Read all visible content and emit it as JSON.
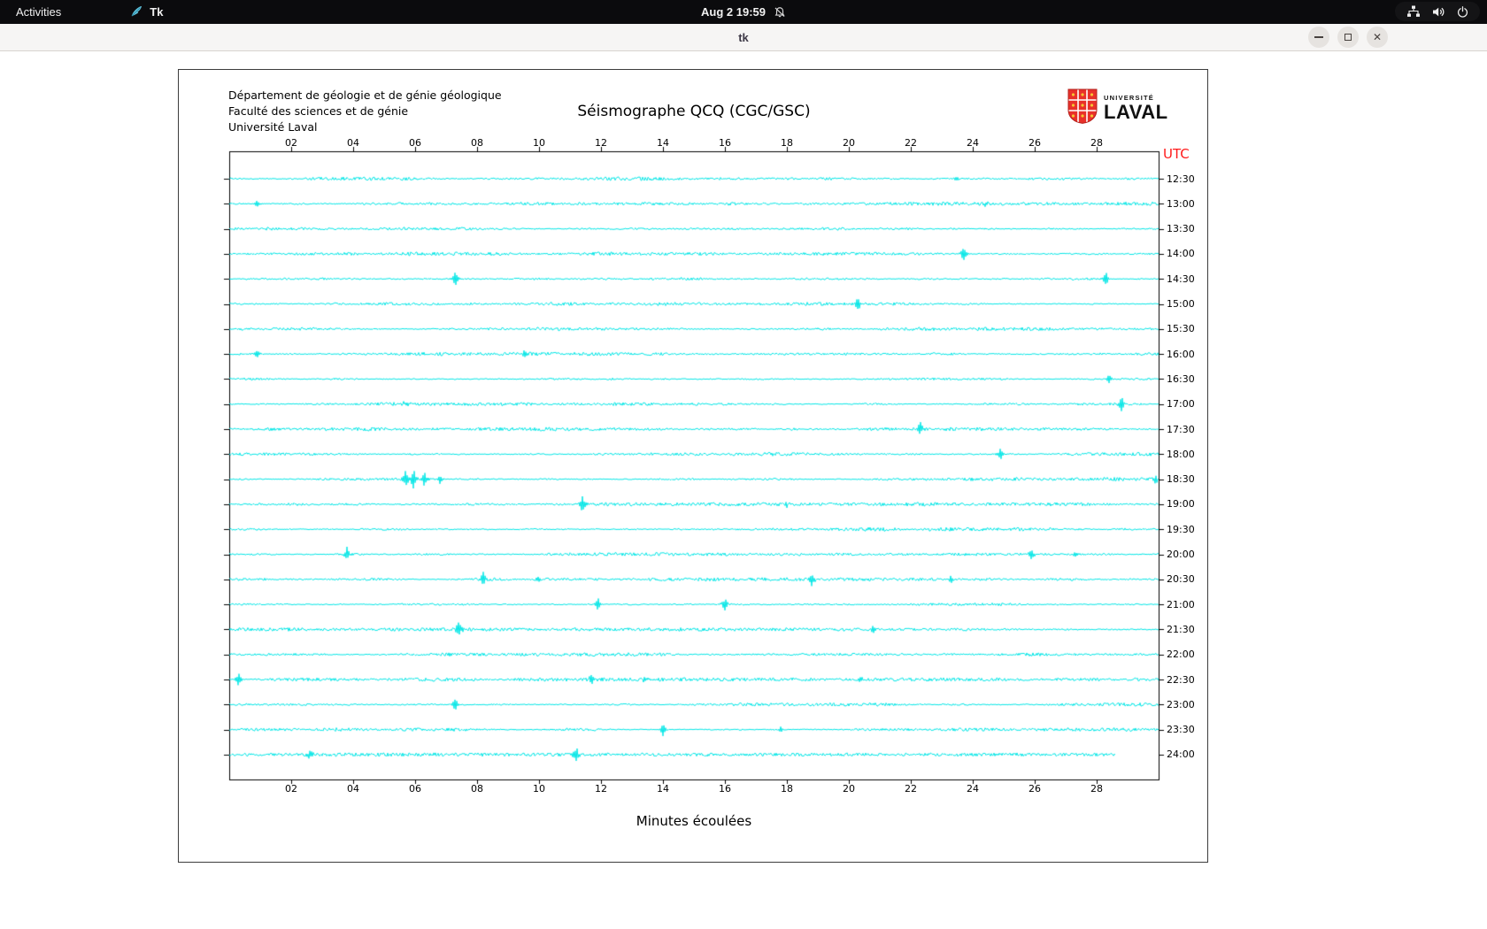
{
  "top_bar": {
    "activities_label": "Activities",
    "app_name": "Tk",
    "clock": "Aug 2 19:59",
    "icons": [
      "tk-app-icon",
      "notifications-disabled-icon",
      "network-icon",
      "volume-icon",
      "power-icon"
    ]
  },
  "window": {
    "title": "tk",
    "controls": [
      "minimize",
      "maximize",
      "close"
    ]
  },
  "seismograph": {
    "header_lines": [
      "Département de géologie et de génie géologique",
      "Faculté des sciences et de génie",
      "Université Laval"
    ],
    "title": "Séismographe QCQ (CGC/GSC)",
    "logo": {
      "top": "UNIVERSITÉ",
      "bottom": "LAVAL"
    },
    "utc_label": "UTC",
    "xlabel": "Minutes écoulées",
    "x_ticks": [
      "02",
      "04",
      "06",
      "08",
      "10",
      "12",
      "14",
      "16",
      "18",
      "20",
      "22",
      "24",
      "26",
      "28"
    ],
    "y_labels": [
      "12:30",
      "13:00",
      "13:30",
      "14:00",
      "14:30",
      "15:00",
      "15:30",
      "16:00",
      "16:30",
      "17:00",
      "17:30",
      "18:00",
      "18:30",
      "19:00",
      "19:30",
      "20:00",
      "20:30",
      "21:00",
      "21:30",
      "22:00",
      "22:30",
      "23:00",
      "23:30",
      "24:00"
    ],
    "colors": {
      "trace": "#00e6e6",
      "utc": "#ff1a1a",
      "axis": "#000000"
    },
    "last_trace_end_min": 28.6,
    "events": [
      {
        "r": 0,
        "m": 3.7,
        "a": 4
      },
      {
        "r": 0,
        "m": 23.5,
        "a": 3
      },
      {
        "r": 1,
        "m": 0.9,
        "a": 4
      },
      {
        "r": 1,
        "m": 24.4,
        "a": 3
      },
      {
        "r": 3,
        "m": 23.7,
        "a": 8
      },
      {
        "r": 4,
        "m": 7.3,
        "a": 9
      },
      {
        "r": 4,
        "m": 28.3,
        "a": 8
      },
      {
        "r": 5,
        "m": 20.3,
        "a": 8
      },
      {
        "r": 7,
        "m": 0.9,
        "a": 4
      },
      {
        "r": 7,
        "m": 9.5,
        "a": 3
      },
      {
        "r": 8,
        "m": 28.4,
        "a": 5
      },
      {
        "r": 9,
        "m": 5.7,
        "a": 4
      },
      {
        "r": 9,
        "m": 28.8,
        "a": 9
      },
      {
        "r": 10,
        "m": 22.3,
        "a": 8
      },
      {
        "r": 11,
        "m": 24.9,
        "a": 7
      },
      {
        "r": 12,
        "m": 5.7,
        "a": 10
      },
      {
        "r": 12,
        "m": 5.95,
        "a": 12
      },
      {
        "r": 12,
        "m": 6.3,
        "a": 8
      },
      {
        "r": 12,
        "m": 6.8,
        "a": 5
      },
      {
        "r": 12,
        "m": 29.9,
        "a": 5
      },
      {
        "r": 13,
        "m": 11.4,
        "a": 9
      },
      {
        "r": 13,
        "m": 18.0,
        "a": 3
      },
      {
        "r": 15,
        "m": 3.8,
        "a": 8
      },
      {
        "r": 15,
        "m": 25.9,
        "a": 6
      },
      {
        "r": 15,
        "m": 27.3,
        "a": 3
      },
      {
        "r": 16,
        "m": 8.2,
        "a": 8
      },
      {
        "r": 16,
        "m": 10.0,
        "a": 3
      },
      {
        "r": 16,
        "m": 18.8,
        "a": 9
      },
      {
        "r": 16,
        "m": 23.3,
        "a": 4
      },
      {
        "r": 17,
        "m": 11.9,
        "a": 8
      },
      {
        "r": 17,
        "m": 16.0,
        "a": 7
      },
      {
        "r": 18,
        "m": 7.4,
        "a": 9
      },
      {
        "r": 18,
        "m": 20.8,
        "a": 5
      },
      {
        "r": 20,
        "m": 0.3,
        "a": 7
      },
      {
        "r": 20,
        "m": 11.7,
        "a": 8
      },
      {
        "r": 20,
        "m": 13.4,
        "a": 4
      },
      {
        "r": 20,
        "m": 20.4,
        "a": 3
      },
      {
        "r": 21,
        "m": 7.3,
        "a": 8
      },
      {
        "r": 22,
        "m": 14.0,
        "a": 7
      },
      {
        "r": 22,
        "m": 17.8,
        "a": 3
      },
      {
        "r": 23,
        "m": 2.6,
        "a": 6
      },
      {
        "r": 23,
        "m": 11.2,
        "a": 9
      }
    ]
  }
}
